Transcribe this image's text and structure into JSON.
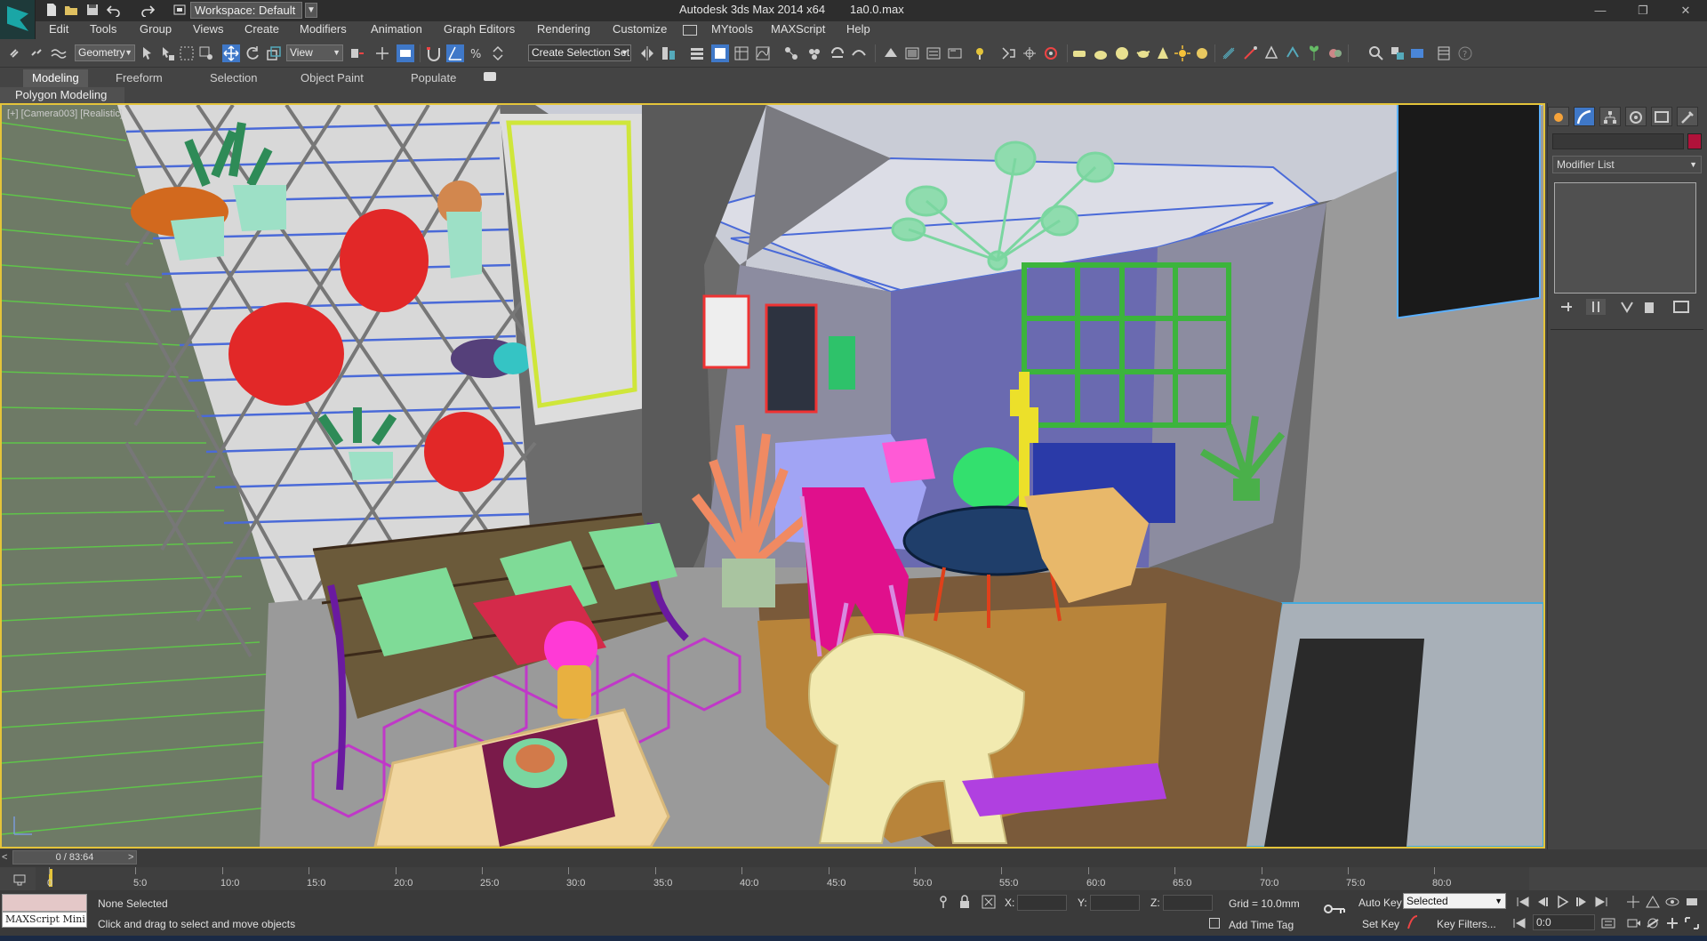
{
  "window": {
    "app_title": "Autodesk 3ds Max  2014 x64",
    "file_name": "1a0.0.max",
    "workspace": "Workspace: Default",
    "controls": [
      "—",
      "❐",
      "✕"
    ]
  },
  "menu": [
    "Edit",
    "Tools",
    "Group",
    "Views",
    "Create",
    "Modifiers",
    "Animation",
    "Graph Editors",
    "Rendering",
    "Customize",
    "MYtools",
    "MAXScript",
    "Help"
  ],
  "toolbar": {
    "selection_filter": "Geometry",
    "ref_coord": "View",
    "named_selection": "Create Selection Set"
  },
  "ribbon": {
    "tabs": [
      "Modeling",
      "Freeform",
      "Selection",
      "Object Paint",
      "Populate"
    ],
    "active_tab": "Modeling",
    "panel_label": "Polygon Modeling"
  },
  "viewport": {
    "label": "[+] [Camera003] [Realistic]"
  },
  "command_panel": {
    "modifier_list": "Modifier List",
    "object_color": "#b0123a"
  },
  "timeline": {
    "slider_text": "0 / 83:64",
    "ticks": [
      "0",
      "5:0",
      "10:0",
      "15:0",
      "20:0",
      "25:0",
      "30:0",
      "35:0",
      "40:0",
      "45:0",
      "50:0",
      "55:0",
      "60:0",
      "65:0",
      "70:0",
      "75:0",
      "80:0"
    ]
  },
  "status": {
    "selection": "None Selected",
    "prompt": "Click and drag to select and move objects",
    "maxscript": "MAXScript Mini",
    "x_label": "X:",
    "y_label": "Y:",
    "z_label": "Z:",
    "grid": "Grid = 10.0mm",
    "add_time_tag": "Add Time Tag",
    "auto_key": "Auto Key",
    "set_key": "Set Key",
    "key_mode": "Selected",
    "key_filters": "Key Filters...",
    "frame": "0:0"
  },
  "colors": {
    "accent_yellow": "#e4c43a",
    "ui_dark": "#444444"
  }
}
